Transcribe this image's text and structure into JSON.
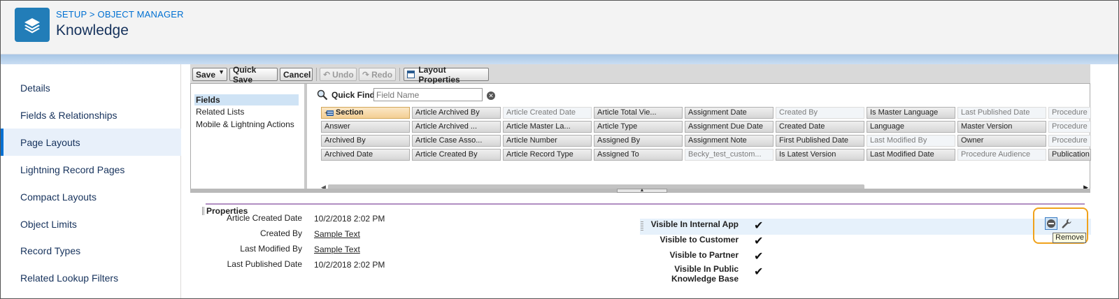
{
  "header": {
    "breadcrumb": "SETUP > OBJECT MANAGER",
    "title": "Knowledge",
    "icon": "layers-icon"
  },
  "sidebar": {
    "items": [
      {
        "label": "Details"
      },
      {
        "label": "Fields & Relationships"
      },
      {
        "label": "Page Layouts",
        "active": true
      },
      {
        "label": "Lightning Record Pages"
      },
      {
        "label": "Compact Layouts"
      },
      {
        "label": "Object Limits"
      },
      {
        "label": "Record Types"
      },
      {
        "label": "Related Lookup Filters"
      }
    ]
  },
  "toolbar": {
    "save": "Save",
    "quick_save": "Quick Save",
    "cancel": "Cancel",
    "undo": "Undo",
    "redo": "Redo",
    "layout_properties": "Layout Properties"
  },
  "palette": {
    "categories": [
      "Fields",
      "Related Lists",
      "Mobile & Lightning Actions"
    ],
    "quick_find_label": "Quick Find",
    "quick_find_placeholder": "Field Name",
    "columns": [
      [
        "Section",
        "Answer",
        "Archived By",
        "Archived Date"
      ],
      [
        "Article Archived By",
        "Article Archived ...",
        "Article Case Asso...",
        "Article Created By"
      ],
      [
        "Article Created Date",
        "Article Master La...",
        "Article Number",
        "Article Record Type"
      ],
      [
        "Article Total Vie...",
        "Article Type",
        "Assigned By",
        "Assigned To"
      ],
      [
        "Assignment Date",
        "Assignment Due Date",
        "Assignment Note",
        "Becky_test_custom..."
      ],
      [
        "Created By",
        "Created Date",
        "First Published Date",
        "Is Latest Version"
      ],
      [
        "Is Master Language",
        "Language",
        "Last Modified By",
        "Last Modified Date"
      ],
      [
        "Last Published Date",
        "Master Version",
        "Owner",
        "Procedure Audience"
      ],
      [
        "Procedure",
        "Procedure",
        "Procedure",
        "Publication"
      ]
    ],
    "used": [
      [
        false,
        false,
        false,
        false
      ],
      [
        false,
        false,
        false,
        false
      ],
      [
        true,
        false,
        false,
        false
      ],
      [
        false,
        false,
        false,
        false
      ],
      [
        false,
        false,
        false,
        true
      ],
      [
        true,
        false,
        false,
        false
      ],
      [
        false,
        false,
        true,
        false
      ],
      [
        true,
        false,
        false,
        true
      ],
      [
        true,
        true,
        true,
        false
      ]
    ]
  },
  "layout": {
    "section_title": "Properties",
    "left_fields": [
      {
        "label": "Article Created Date",
        "value": "10/2/2018 2:02 PM",
        "link": false
      },
      {
        "label": "Created By",
        "value": "Sample Text",
        "link": true
      },
      {
        "label": "Last Modified By",
        "value": "Sample Text",
        "link": true
      },
      {
        "label": "Last Published Date",
        "value": "10/2/2018 2:02 PM",
        "link": false
      }
    ],
    "right_fields": [
      {
        "label": "Visible In Internal App",
        "value": "✔"
      },
      {
        "label": "Visible to Customer",
        "value": "✔"
      },
      {
        "label": "Visible to Partner",
        "value": "✔"
      },
      {
        "label": "Visible In Public Knowledge Base",
        "value": "✔"
      }
    ],
    "tooltip": "Remove"
  },
  "colors": {
    "accent": "#0070d2",
    "header_icon": "#227db8",
    "callout": "#f0a21b",
    "section_line": "#b18ec2"
  }
}
